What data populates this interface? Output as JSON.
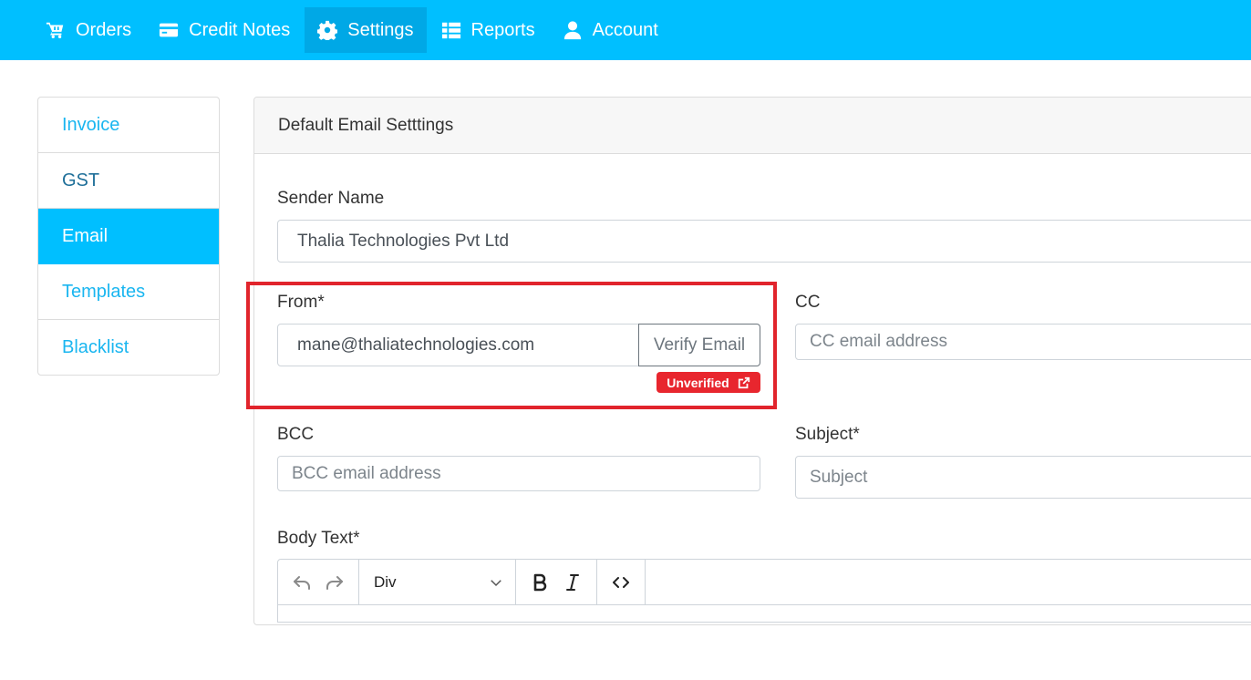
{
  "nav": {
    "items": [
      {
        "label": "Orders",
        "icon": "cart-icon"
      },
      {
        "label": "Credit Notes",
        "icon": "credit-card-icon"
      },
      {
        "label": "Settings",
        "icon": "gear-icon",
        "active": true
      },
      {
        "label": "Reports",
        "icon": "table-icon"
      },
      {
        "label": "Account",
        "icon": "user-icon"
      }
    ]
  },
  "sidebar": {
    "items": [
      {
        "label": "Invoice"
      },
      {
        "label": "GST"
      },
      {
        "label": "Email",
        "active": true
      },
      {
        "label": "Templates"
      },
      {
        "label": "Blacklist"
      }
    ]
  },
  "card": {
    "title": "Default Email Setttings"
  },
  "form": {
    "sender_name_label": "Sender Name",
    "sender_name_value": "Thalia Technologies Pvt Ltd",
    "from_label": "From*",
    "from_value": "mane@thaliatechnologies.com",
    "verify_button": "Verify Email",
    "status_badge": "Unverified",
    "cc_label": "CC",
    "cc_placeholder": "CC email address",
    "bcc_label": "BCC",
    "bcc_placeholder": "BCC email address",
    "subject_label": "Subject*",
    "subject_placeholder": "Subject",
    "body_label": "Body Text*"
  },
  "editor": {
    "format_select": "Div"
  },
  "colors": {
    "brand": "#00bfff",
    "danger": "#e8262e",
    "highlight_box": "#e1242c"
  }
}
